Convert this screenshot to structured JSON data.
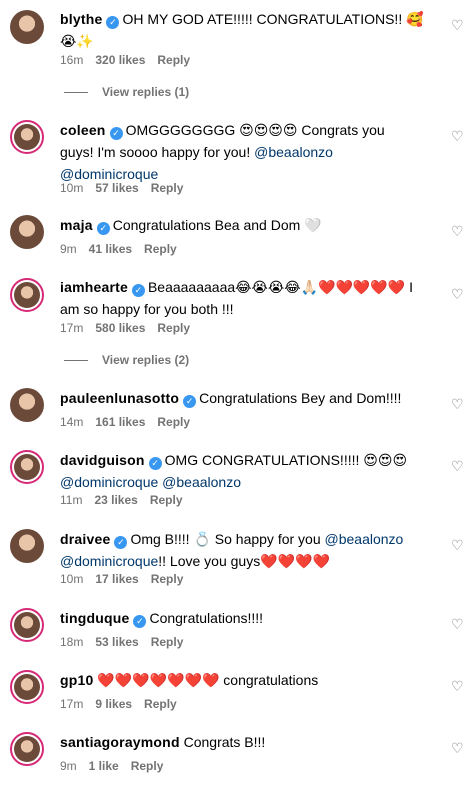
{
  "comments": [
    {
      "user": "blythe",
      "text": "OH MY GOD ATE!!!!! CONGRATULATIONS!! 🥰",
      "text2": "😭✨",
      "time": "16m",
      "likes": "320 likes",
      "reply": "Reply"
    },
    {
      "user": "coleen",
      "text": "OMGGGGGGGG 😍😍😍😍 Congrats you",
      "text2": "guys! I'm soooo happy for you!",
      "mention1": "@beaalonzo",
      "mention2": "@dominicroque",
      "time": "10m",
      "likes": "57 likes",
      "reply": "Reply"
    },
    {
      "user": "maja",
      "text": "Congratulations Bea and Dom 🤍",
      "time": "9m",
      "likes": "41 likes",
      "reply": "Reply"
    },
    {
      "user": "iamhearte",
      "text": "Beaaaaaaaaa😂😭😭😂🙏🏻❤️❤️❤️❤️❤️ I",
      "text2": "am so happy for you both !!!",
      "time": "17m",
      "likes": "580 likes",
      "reply": "Reply"
    },
    {
      "user": "pauleenlunasotto",
      "text": "Congratulations Bey and Dom!!!!",
      "time": "14m",
      "likes": "161 likes",
      "reply": "Reply"
    },
    {
      "user": "davidguison",
      "text": "OMG CONGRATULATIONS!!!!! 😍😍😍",
      "mention1": "@dominicroque",
      "mention2": "@beaalonzo",
      "time": "11m",
      "likes": "23 likes",
      "reply": "Reply"
    },
    {
      "user": "draivee",
      "text": "Omg B!!!! 💍 So happy for you",
      "mention1": "@beaalonzo",
      "mention2": "@dominicroque",
      "text3": "!! Love you guys❤️❤️❤️❤️",
      "time": "10m",
      "likes": "17 likes",
      "reply": "Reply"
    },
    {
      "user": "tingduque",
      "text": "Congratulations!!!!",
      "time": "18m",
      "likes": "53 likes",
      "reply": "Reply"
    },
    {
      "user": "gp10",
      "text": "❤️❤️❤️❤️❤️❤️❤️ congratulations",
      "time": "17m",
      "likes": "9 likes",
      "reply": "Reply"
    },
    {
      "user": "santiagoraymond",
      "text": "Congrats B!!!",
      "time": "9m",
      "likes": "1 like",
      "reply": "Reply"
    }
  ],
  "view_replies": [
    "View replies (1)",
    "View replies (2)"
  ],
  "colors": {
    "verified": "#3897f0",
    "mention": "#00376b",
    "meta": "#737373"
  }
}
